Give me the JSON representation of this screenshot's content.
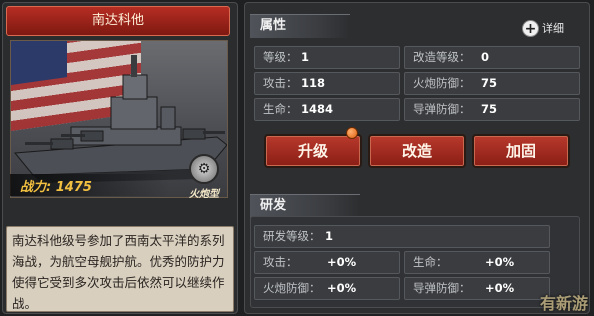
{
  "ship": {
    "name": "南达科他",
    "power_label": "战力: 1475",
    "type_icon": "gear-icon",
    "type_label": "火炮型",
    "description": "南达科他级号参加了西南太平洋的系列海战，为航空母舰护航。优秀的防护力使得它受到多次攻击后依然可以继续作战。"
  },
  "attributes": {
    "header": "属性",
    "detail_label": "详细",
    "level": {
      "label": "等级：",
      "value": "1"
    },
    "mod_level": {
      "label": "改造等级：",
      "value": "0"
    },
    "attack": {
      "label": "攻击：",
      "value": "118"
    },
    "gun_def": {
      "label": "火炮防御：",
      "value": "75"
    },
    "hp": {
      "label": "生命：",
      "value": "1484"
    },
    "missile_def": {
      "label": "导弹防御：",
      "value": "75"
    }
  },
  "actions": {
    "upgrade": "升级",
    "modify": "改造",
    "reinforce": "加固"
  },
  "research": {
    "header": "研发",
    "level": {
      "label": "研发等级：",
      "value": "1"
    },
    "attack": {
      "label": "攻击：",
      "value": "+0%"
    },
    "hp": {
      "label": "生命：",
      "value": "+0%"
    },
    "gun_def": {
      "label": "火炮防御：",
      "value": "+0%"
    },
    "missile_def": {
      "label": "导弹防御：",
      "value": "+0%"
    }
  },
  "watermark": "有新游",
  "colors": {
    "accent_red": "#b62d23",
    "power_gold": "#f2c040",
    "notify_orange": "#e06010"
  }
}
